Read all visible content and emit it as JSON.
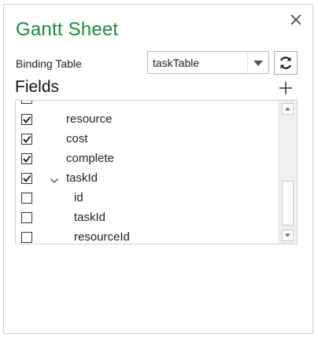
{
  "panel": {
    "title": "Gantt Sheet",
    "close_icon": "close-icon"
  },
  "binding": {
    "label": "Binding Table",
    "selected": "taskTable",
    "refresh_icon": "refresh-icon"
  },
  "fields": {
    "title": "Fields",
    "add_icon": "plus-icon",
    "items": [
      {
        "label": "resource",
        "checked": true,
        "level": 0,
        "expandable": false
      },
      {
        "label": "cost",
        "checked": true,
        "level": 0,
        "expandable": false
      },
      {
        "label": "complete",
        "checked": true,
        "level": 0,
        "expandable": false
      },
      {
        "label": "taskId",
        "checked": true,
        "level": 0,
        "expandable": true,
        "expanded": true
      },
      {
        "label": "id",
        "checked": false,
        "level": 1,
        "expandable": false
      },
      {
        "label": "taskId",
        "checked": false,
        "level": 1,
        "expandable": false
      },
      {
        "label": "resourceId",
        "checked": false,
        "level": 1,
        "expandable": false
      }
    ]
  },
  "colors": {
    "title": "#1a8c3a",
    "border": "#cfcfcf"
  }
}
